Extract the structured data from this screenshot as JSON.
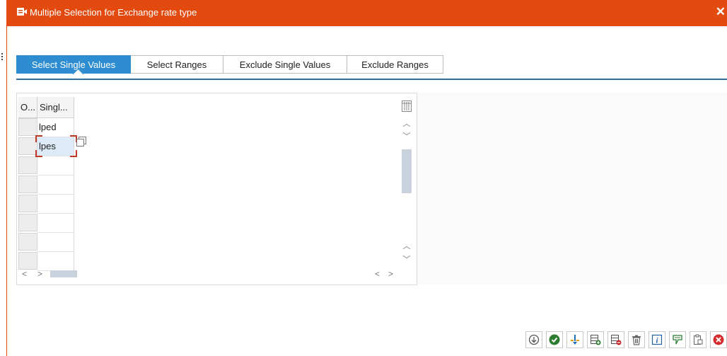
{
  "window": {
    "title": "Multiple Selection for Exchange rate type",
    "close_glyph": "✕",
    "colors": {
      "titlebar": "#e34a10",
      "accent": "#2d8dd0"
    }
  },
  "tabs": [
    {
      "label": "Select Single Values",
      "active": true
    },
    {
      "label": "Select Ranges",
      "active": false
    },
    {
      "label": "Exclude Single Values",
      "active": false
    },
    {
      "label": "Exclude Ranges",
      "active": false
    }
  ],
  "grid": {
    "columns": [
      {
        "label": "O..."
      },
      {
        "label": "Singl..."
      }
    ],
    "rows": [
      {
        "value": "lped"
      },
      {
        "value": "lpes"
      },
      {
        "value": ""
      },
      {
        "value": ""
      },
      {
        "value": ""
      },
      {
        "value": ""
      },
      {
        "value": ""
      },
      {
        "value": ""
      }
    ]
  },
  "toolbar": {
    "icons": [
      "execute-icon",
      "check-icon",
      "import-icon",
      "insert-row-icon",
      "delete-row-icon",
      "delete-all-icon",
      "info-icon",
      "filter-icon",
      "clipboard-upload-icon",
      "cancel-icon"
    ]
  }
}
